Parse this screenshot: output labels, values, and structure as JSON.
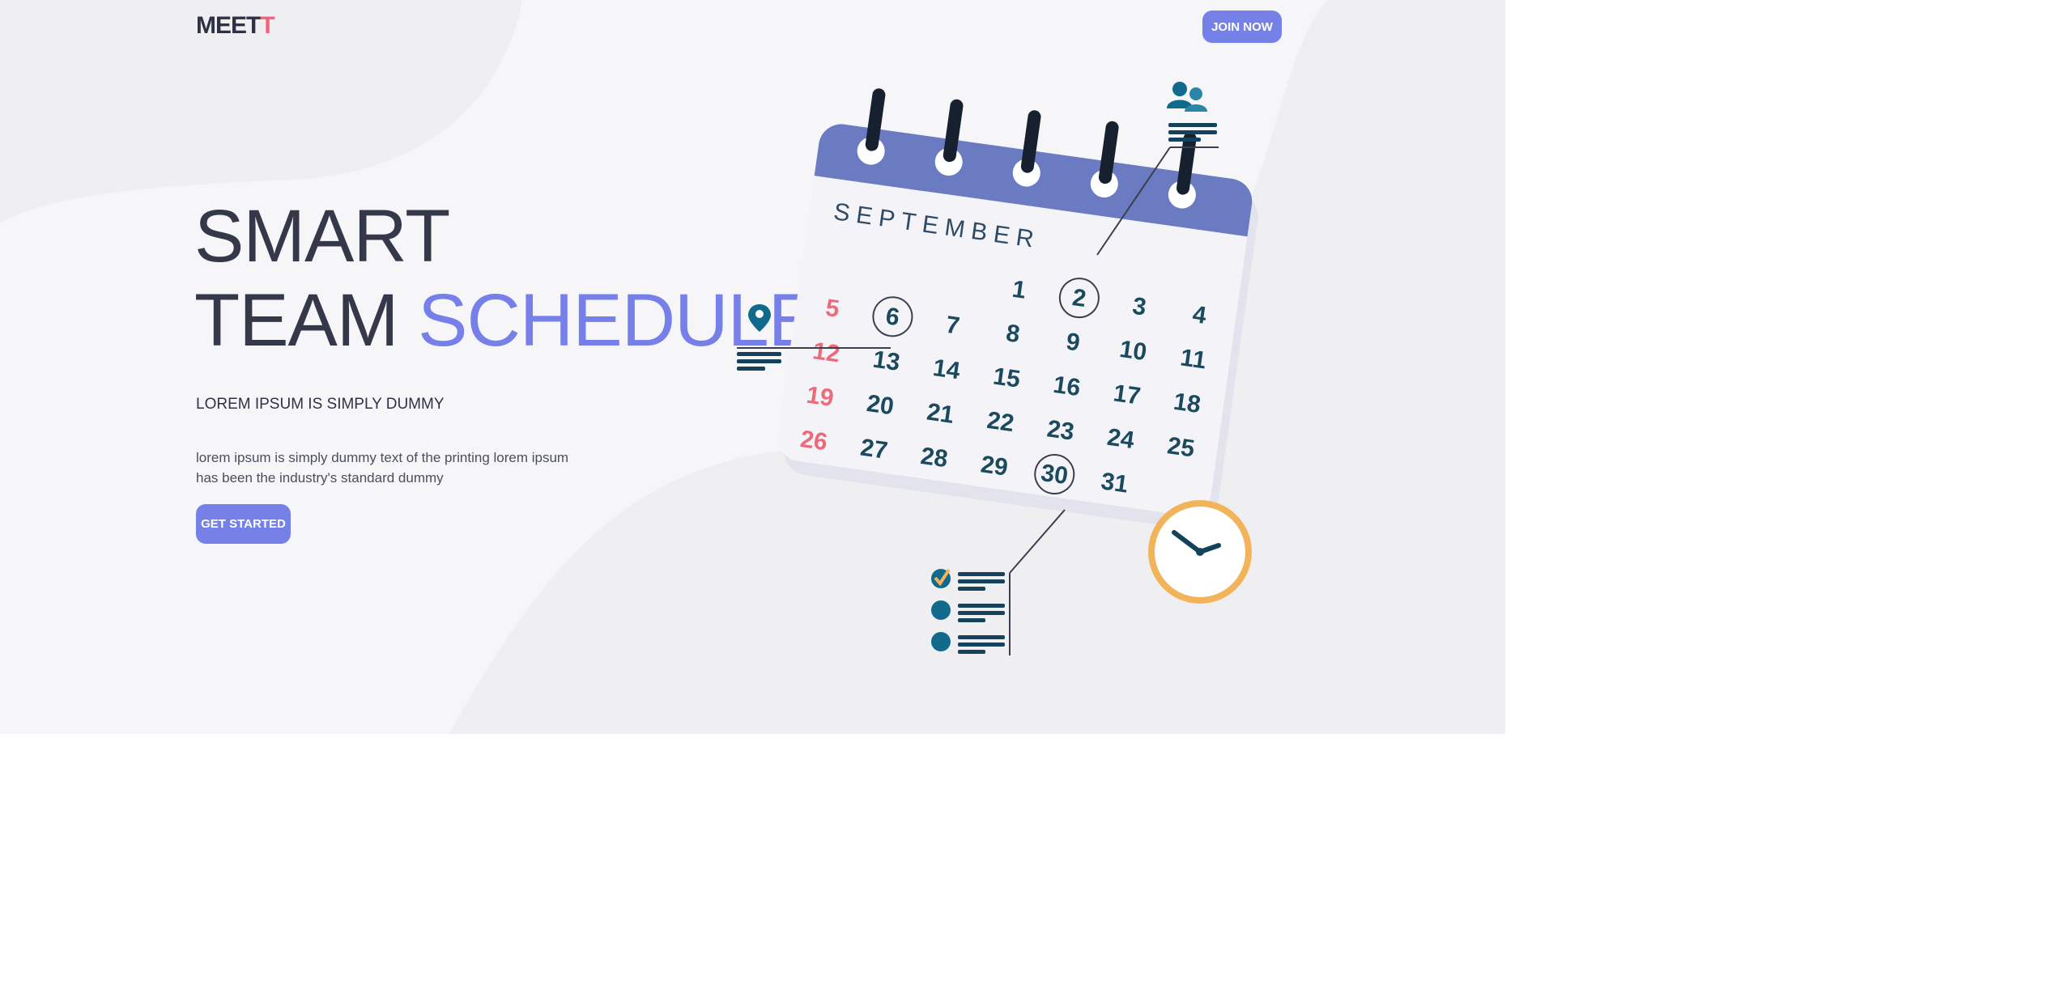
{
  "header": {
    "logo_main": "MEET",
    "logo_accent": "T",
    "join_label": "JOIN NOW"
  },
  "hero": {
    "headline_line1": "SMART",
    "headline_word_team": "TEAM",
    "headline_word_schedule": "SCHEDULE",
    "subheading": "LOREM IPSUM IS SIMPLY DUMMY",
    "body": "lorem ipsum is simply dummy text of the printing lorem ipsum has been the industry's standard dummy",
    "cta_label": "GET STARTED"
  },
  "calendar": {
    "month": "SEPTEMBER",
    "days": [
      "1",
      "2",
      "3",
      "4",
      "5",
      "6",
      "7",
      "8",
      "9",
      "10",
      "11",
      "12",
      "13",
      "14",
      "15",
      "16",
      "17",
      "18",
      "19",
      "20",
      "21",
      "22",
      "23",
      "24",
      "25",
      "26",
      "27",
      "28",
      "29",
      "30",
      "31"
    ],
    "highlighted_days": [
      "2",
      "6",
      "30"
    ],
    "red_days": [
      "5",
      "12",
      "19",
      "26"
    ]
  },
  "colors": {
    "accent": "#7681e8",
    "logo_accent": "#f0637a",
    "calendar_header": "#6b7bc2",
    "day_text": "#1b4a5e",
    "weekend_text": "#ec6a7c",
    "clock_ring": "#f2b45a",
    "icon_teal": "#0f6a8b"
  },
  "icons": {
    "location": "location-pin-icon",
    "team": "team-people-icon",
    "checklist": "checklist-icon",
    "clock": "clock-icon"
  }
}
